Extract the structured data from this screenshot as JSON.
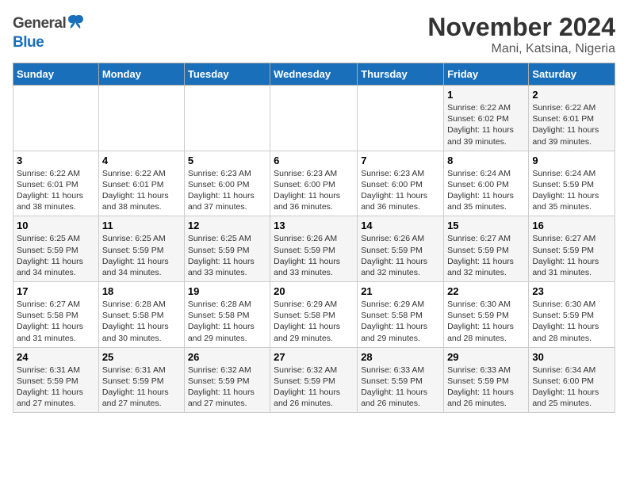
{
  "logo": {
    "general": "General",
    "blue": "Blue"
  },
  "header": {
    "month": "November 2024",
    "location": "Mani, Katsina, Nigeria"
  },
  "weekdays": [
    "Sunday",
    "Monday",
    "Tuesday",
    "Wednesday",
    "Thursday",
    "Friday",
    "Saturday"
  ],
  "weeks": [
    [
      {
        "day": "",
        "info": ""
      },
      {
        "day": "",
        "info": ""
      },
      {
        "day": "",
        "info": ""
      },
      {
        "day": "",
        "info": ""
      },
      {
        "day": "",
        "info": ""
      },
      {
        "day": "1",
        "info": "Sunrise: 6:22 AM\nSunset: 6:02 PM\nDaylight: 11 hours and 39 minutes."
      },
      {
        "day": "2",
        "info": "Sunrise: 6:22 AM\nSunset: 6:01 PM\nDaylight: 11 hours and 39 minutes."
      }
    ],
    [
      {
        "day": "3",
        "info": "Sunrise: 6:22 AM\nSunset: 6:01 PM\nDaylight: 11 hours and 38 minutes."
      },
      {
        "day": "4",
        "info": "Sunrise: 6:22 AM\nSunset: 6:01 PM\nDaylight: 11 hours and 38 minutes."
      },
      {
        "day": "5",
        "info": "Sunrise: 6:23 AM\nSunset: 6:00 PM\nDaylight: 11 hours and 37 minutes."
      },
      {
        "day": "6",
        "info": "Sunrise: 6:23 AM\nSunset: 6:00 PM\nDaylight: 11 hours and 36 minutes."
      },
      {
        "day": "7",
        "info": "Sunrise: 6:23 AM\nSunset: 6:00 PM\nDaylight: 11 hours and 36 minutes."
      },
      {
        "day": "8",
        "info": "Sunrise: 6:24 AM\nSunset: 6:00 PM\nDaylight: 11 hours and 35 minutes."
      },
      {
        "day": "9",
        "info": "Sunrise: 6:24 AM\nSunset: 5:59 PM\nDaylight: 11 hours and 35 minutes."
      }
    ],
    [
      {
        "day": "10",
        "info": "Sunrise: 6:25 AM\nSunset: 5:59 PM\nDaylight: 11 hours and 34 minutes."
      },
      {
        "day": "11",
        "info": "Sunrise: 6:25 AM\nSunset: 5:59 PM\nDaylight: 11 hours and 34 minutes."
      },
      {
        "day": "12",
        "info": "Sunrise: 6:25 AM\nSunset: 5:59 PM\nDaylight: 11 hours and 33 minutes."
      },
      {
        "day": "13",
        "info": "Sunrise: 6:26 AM\nSunset: 5:59 PM\nDaylight: 11 hours and 33 minutes."
      },
      {
        "day": "14",
        "info": "Sunrise: 6:26 AM\nSunset: 5:59 PM\nDaylight: 11 hours and 32 minutes."
      },
      {
        "day": "15",
        "info": "Sunrise: 6:27 AM\nSunset: 5:59 PM\nDaylight: 11 hours and 32 minutes."
      },
      {
        "day": "16",
        "info": "Sunrise: 6:27 AM\nSunset: 5:59 PM\nDaylight: 11 hours and 31 minutes."
      }
    ],
    [
      {
        "day": "17",
        "info": "Sunrise: 6:27 AM\nSunset: 5:58 PM\nDaylight: 11 hours and 31 minutes."
      },
      {
        "day": "18",
        "info": "Sunrise: 6:28 AM\nSunset: 5:58 PM\nDaylight: 11 hours and 30 minutes."
      },
      {
        "day": "19",
        "info": "Sunrise: 6:28 AM\nSunset: 5:58 PM\nDaylight: 11 hours and 29 minutes."
      },
      {
        "day": "20",
        "info": "Sunrise: 6:29 AM\nSunset: 5:58 PM\nDaylight: 11 hours and 29 minutes."
      },
      {
        "day": "21",
        "info": "Sunrise: 6:29 AM\nSunset: 5:58 PM\nDaylight: 11 hours and 29 minutes."
      },
      {
        "day": "22",
        "info": "Sunrise: 6:30 AM\nSunset: 5:59 PM\nDaylight: 11 hours and 28 minutes."
      },
      {
        "day": "23",
        "info": "Sunrise: 6:30 AM\nSunset: 5:59 PM\nDaylight: 11 hours and 28 minutes."
      }
    ],
    [
      {
        "day": "24",
        "info": "Sunrise: 6:31 AM\nSunset: 5:59 PM\nDaylight: 11 hours and 27 minutes."
      },
      {
        "day": "25",
        "info": "Sunrise: 6:31 AM\nSunset: 5:59 PM\nDaylight: 11 hours and 27 minutes."
      },
      {
        "day": "26",
        "info": "Sunrise: 6:32 AM\nSunset: 5:59 PM\nDaylight: 11 hours and 27 minutes."
      },
      {
        "day": "27",
        "info": "Sunrise: 6:32 AM\nSunset: 5:59 PM\nDaylight: 11 hours and 26 minutes."
      },
      {
        "day": "28",
        "info": "Sunrise: 6:33 AM\nSunset: 5:59 PM\nDaylight: 11 hours and 26 minutes."
      },
      {
        "day": "29",
        "info": "Sunrise: 6:33 AM\nSunset: 5:59 PM\nDaylight: 11 hours and 26 minutes."
      },
      {
        "day": "30",
        "info": "Sunrise: 6:34 AM\nSunset: 6:00 PM\nDaylight: 11 hours and 25 minutes."
      }
    ]
  ]
}
